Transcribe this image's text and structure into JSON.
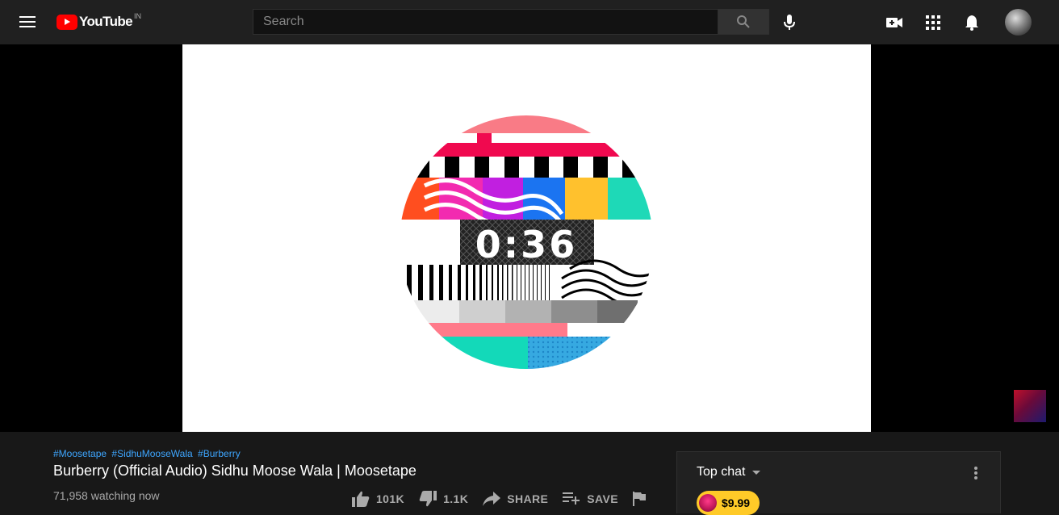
{
  "header": {
    "logo_text": "YouTube",
    "region": "IN",
    "search_placeholder": "Search",
    "icons": [
      "menu-icon",
      "search-icon",
      "mic-icon",
      "create-video-icon",
      "apps-grid-icon",
      "notifications-bell-icon"
    ]
  },
  "player": {
    "countdown": "0:36"
  },
  "video": {
    "hashtags": [
      "#Moosetape",
      "#SidhuMooseWala",
      "#Burberry"
    ],
    "title": "Burberry (Official Audio) Sidhu Moose Wala | Moosetape",
    "viewers": "71,958 watching now",
    "actions": {
      "like": "101K",
      "dislike": "1.1K",
      "share": "SHARE",
      "save": "SAVE"
    }
  },
  "chat": {
    "mode": "Top chat",
    "superchat_amount": "$9.99"
  },
  "colors": {
    "brand_red": "#ff0000",
    "link_blue": "#3ea6ff",
    "superchat_yellow": "#ffca28",
    "background": "#181818",
    "topbar": "#202020"
  }
}
